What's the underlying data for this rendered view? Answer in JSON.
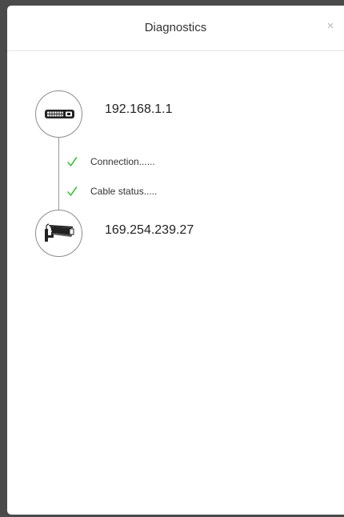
{
  "dialog": {
    "title": "Diagnostics",
    "close_glyph": "×"
  },
  "source": {
    "icon": "network-switch-icon",
    "ip": "192.168.1.1"
  },
  "steps": [
    {
      "icon": "check-icon",
      "label": "Connection......",
      "status": "ok"
    },
    {
      "icon": "check-icon",
      "label": "Cable status.....",
      "status": "ok"
    }
  ],
  "target": {
    "icon": "camera-icon",
    "ip": "169.254.239.27"
  },
  "colors": {
    "check": "#3cc33c",
    "line": "#9a9a9a"
  }
}
